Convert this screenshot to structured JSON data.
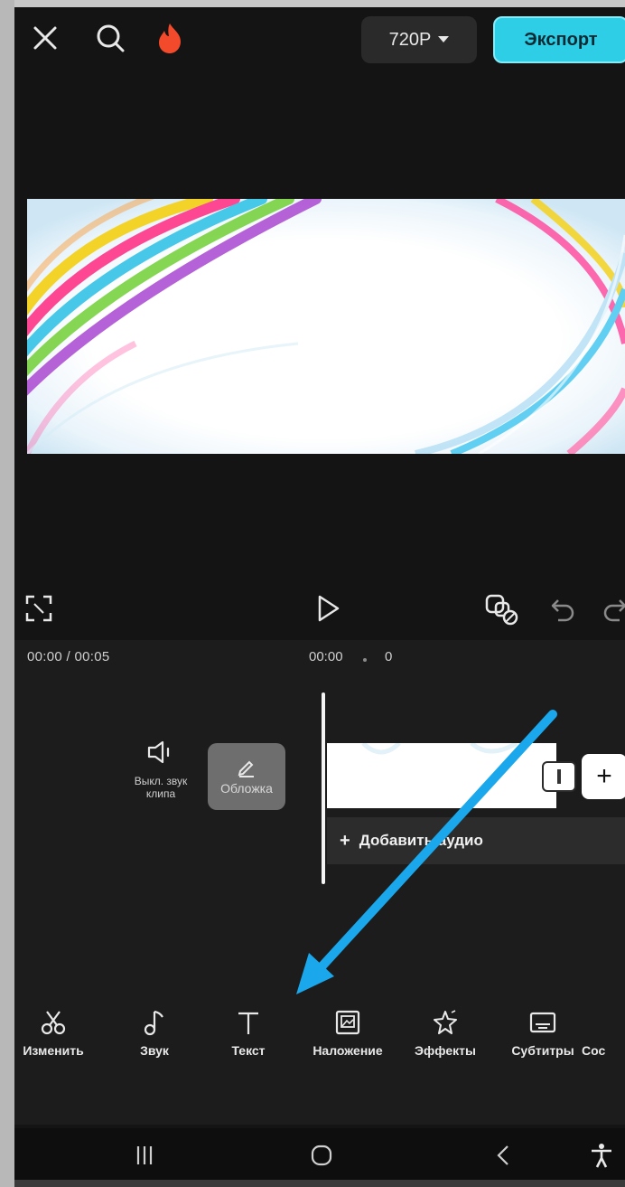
{
  "topbar": {
    "resolution": "720P",
    "export_label": "Экспорт"
  },
  "timeline": {
    "time_display": "00:00 / 00:05",
    "ruler_start": "00:00",
    "ruler_next": "0",
    "mute_label_line1": "Выкл. звук",
    "mute_label_line2": "клипа",
    "cover_label": "Обложка",
    "add_audio_label": "Добавить аудио"
  },
  "toolbar": {
    "items": [
      {
        "label": "Изменить",
        "icon": "scissors-icon"
      },
      {
        "label": "Звук",
        "icon": "music-note-icon"
      },
      {
        "label": "Текст",
        "icon": "text-icon"
      },
      {
        "label": "Наложение",
        "icon": "overlay-icon"
      },
      {
        "label": "Эффекты",
        "icon": "effects-star-icon"
      },
      {
        "label": "Субтитры",
        "icon": "subtitles-icon"
      },
      {
        "label": "Сос",
        "icon": ""
      }
    ]
  },
  "colors": {
    "accent": "#2ecfe6",
    "arrow": "#1aa7ec",
    "background": "#141414"
  }
}
